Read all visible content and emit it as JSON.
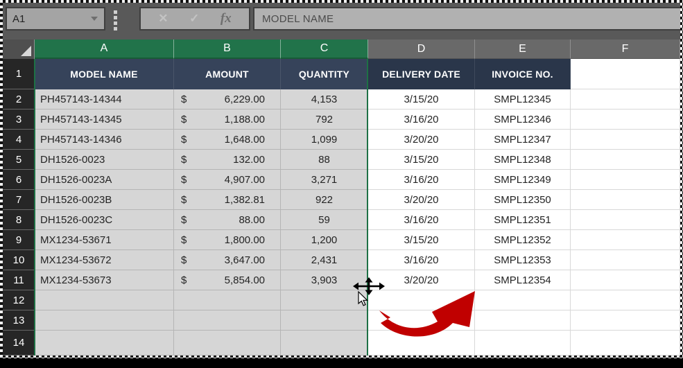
{
  "formula_bar": {
    "name_box": "A1",
    "cancel": "✕",
    "enter": "✓",
    "fx_label": "fx",
    "formula": "MODEL NAME"
  },
  "columns": [
    "A",
    "B",
    "C",
    "D",
    "E",
    "F"
  ],
  "row_numbers": [
    "1",
    "2",
    "3",
    "4",
    "5",
    "6",
    "7",
    "8",
    "9",
    "10",
    "11",
    "12",
    "13",
    "14"
  ],
  "selection": {
    "selected_columns": "A:C",
    "active_cell": "A1"
  },
  "table": {
    "headers": [
      "MODEL NAME",
      "AMOUNT",
      "QUANTITY",
      "DELIVERY DATE",
      "INVOICE NO."
    ],
    "rows": [
      {
        "model": "PH457143-14344",
        "currency": "$",
        "amount": "6,229.00",
        "quantity": "4,153",
        "delivery_date": "3/15/20",
        "invoice": "SMPL12345"
      },
      {
        "model": "PH457143-14345",
        "currency": "$",
        "amount": "1,188.00",
        "quantity": "792",
        "delivery_date": "3/16/20",
        "invoice": "SMPL12346"
      },
      {
        "model": "PH457143-14346",
        "currency": "$",
        "amount": "1,648.00",
        "quantity": "1,099",
        "delivery_date": "3/20/20",
        "invoice": "SMPL12347"
      },
      {
        "model": "DH1526-0023",
        "currency": "$",
        "amount": "132.00",
        "quantity": "88",
        "delivery_date": "3/15/20",
        "invoice": "SMPL12348"
      },
      {
        "model": "DH1526-0023A",
        "currency": "$",
        "amount": "4,907.00",
        "quantity": "3,271",
        "delivery_date": "3/16/20",
        "invoice": "SMPL12349"
      },
      {
        "model": "DH1526-0023B",
        "currency": "$",
        "amount": "1,382.81",
        "quantity": "922",
        "delivery_date": "3/20/20",
        "invoice": "SMPL12350"
      },
      {
        "model": "DH1526-0023C",
        "currency": "$",
        "amount": "88.00",
        "quantity": "59",
        "delivery_date": "3/16/20",
        "invoice": "SMPL12351"
      },
      {
        "model": "MX1234-53671",
        "currency": "$",
        "amount": "1,800.00",
        "quantity": "1,200",
        "delivery_date": "3/15/20",
        "invoice": "SMPL12352"
      },
      {
        "model": "MX1234-53672",
        "currency": "$",
        "amount": "3,647.00",
        "quantity": "2,431",
        "delivery_date": "3/16/20",
        "invoice": "SMPL12353"
      },
      {
        "model": "MX1234-53673",
        "currency": "$",
        "amount": "5,854.00",
        "quantity": "3,903",
        "delivery_date": "3/20/20",
        "invoice": "SMPL12354"
      }
    ]
  },
  "colors": {
    "excel_green": "#21734A",
    "header_navy": "#2E3B4E",
    "selected_fill": "#D6D6D6",
    "chrome_gray": "#595959",
    "arrow_red": "#C00000"
  }
}
